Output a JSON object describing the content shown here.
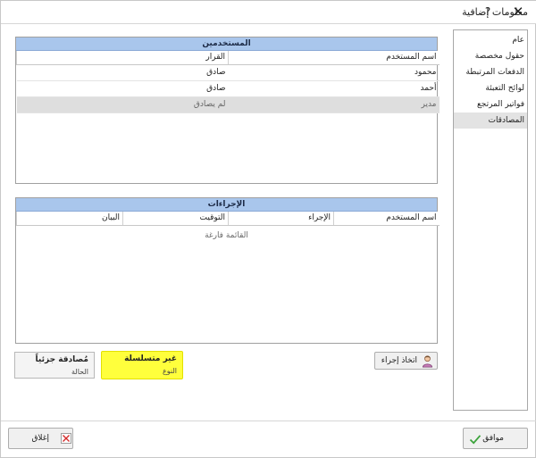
{
  "window": {
    "title": "معلومات إضافية",
    "help_label": "?",
    "close_label": "✕"
  },
  "nav": {
    "items": [
      {
        "label": "عام"
      },
      {
        "label": "حقول مخصصة"
      },
      {
        "label": "الدفعات المرتبطة"
      },
      {
        "label": "لوائح التعبئة"
      },
      {
        "label": "فواتير المرتجع"
      },
      {
        "label": "المصادقات"
      }
    ],
    "active": "المصادقات"
  },
  "users": {
    "header": "المستخدمين",
    "columns": [
      "اسم المستخدم",
      "القرار"
    ],
    "rows": [
      {
        "user": "محمود",
        "decision": "صادق"
      },
      {
        "user": "أحمد",
        "decision": "صادق"
      },
      {
        "user": "مدير",
        "decision": "لم يصادق"
      }
    ]
  },
  "actions": {
    "header": "الإجراءات",
    "columns": [
      "اسم المستخدم",
      "الإجراء",
      "التوقيت",
      "البيان"
    ],
    "empty_text": "القائمة فارغة"
  },
  "take_action_button": {
    "label": "اتخاذ إجراء",
    "icon": "person-icon"
  },
  "type_tile": {
    "value": "غير متسلسلة",
    "caption": "النوع",
    "highlight_color": "#ffff3c"
  },
  "state_tile": {
    "value": "مُصادقة جزئياً",
    "caption": "الحالة"
  },
  "ok_button": {
    "label": "موافق",
    "icon": "checkmark-icon"
  },
  "close_button": {
    "label": "إغلاق",
    "icon": "close-x-icon"
  },
  "colors": {
    "header_bg": "#a9c6ec",
    "selection_bg": "#dedede"
  }
}
